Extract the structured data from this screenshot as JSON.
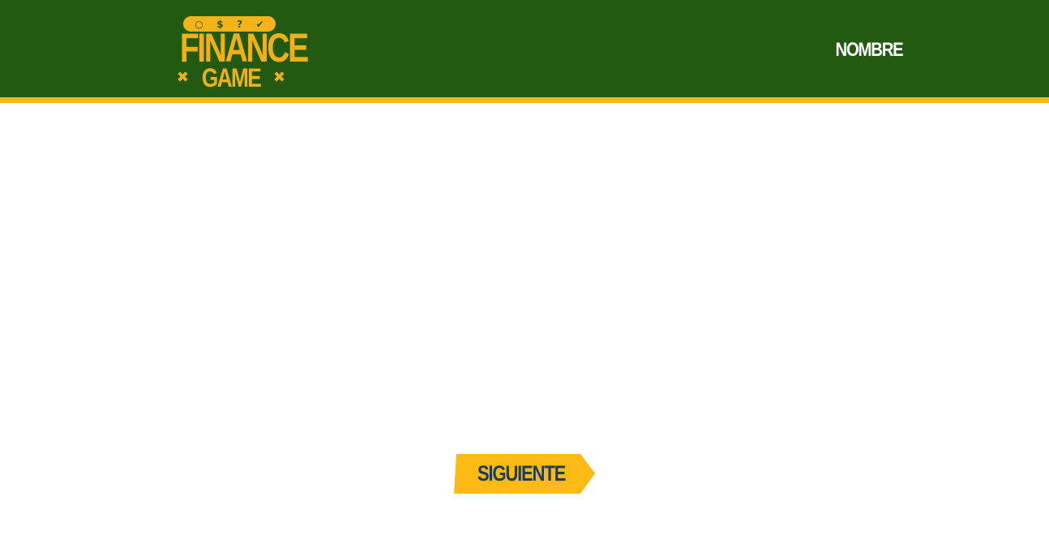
{
  "header": {
    "logo": {
      "top_icons": [
        "circle-icon",
        "dollar-icon",
        "question-icon",
        "check-icon"
      ],
      "word1": "FINANCE",
      "word2": "GAME",
      "color": "#f0b018"
    },
    "player_name": "NOMBRE",
    "background_color": "#215a10",
    "stripe_color": "#f7bb14"
  },
  "main": {
    "next_button_label": "SIGUIENTE",
    "next_button_color": "#ffbb14",
    "next_button_text_color": "#1d3f5e"
  }
}
